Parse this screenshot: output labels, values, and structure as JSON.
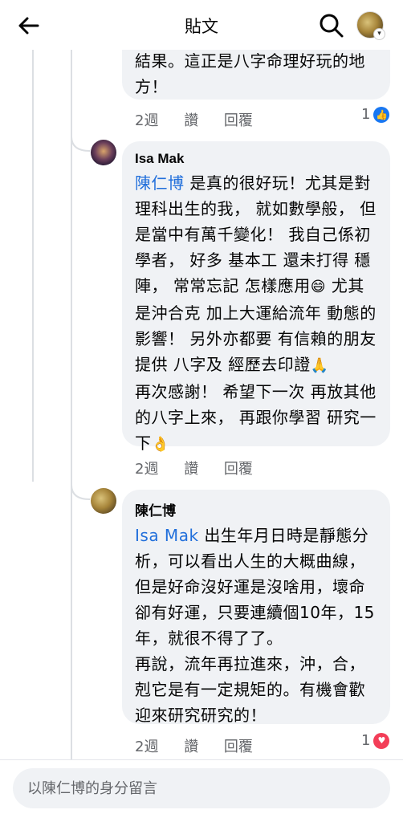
{
  "header": {
    "title": "貼文"
  },
  "comments": [
    {
      "lines": [
        "結果。這正是八字命理好玩的地",
        "方！"
      ],
      "actions": {
        "time": "2週",
        "like": "讚",
        "reply": "回覆"
      },
      "reaction_count": "1"
    },
    {
      "author": "Isa Mak",
      "mention": "陳仁博",
      "first_line_rest": " 是真的很好玩！尤其是對",
      "lines": [
        "理科出生的我， 就如數學般， 但",
        "是當中有萬千變化！ 我自己係初",
        "學者， 好多 基本工 還未打得 穩",
        "陣， 常常忘記 怎樣應用",
        "是沖合克 加上大運給流年 動態的",
        "影響！ 另外亦都要 有信賴的朋友",
        "提供 八字及 經歷去印證",
        "再次感謝！ 希望下一次 再放其他",
        "的八字上來， 再跟你學習 研究一",
        "下"
      ],
      "line4_tail": " 尤其",
      "emojis": {
        "grin": "😄",
        "pray": "🙏",
        "ok": "👌"
      },
      "actions": {
        "time": "2週",
        "like": "讚",
        "reply": "回覆"
      }
    },
    {
      "author": "陳仁博",
      "mention": "Isa Mak",
      "first_line_rest": "  出生年月日時是靜態分",
      "lines": [
        "析，可以看出人生的大概曲線，",
        "但是好命沒好運是沒啥用，壞命",
        "卻有好運，只要連續個10年，15",
        "年，就很不得了了。",
        "再說，流年再拉進來，沖，合，",
        "剋它是有一定規矩的。有機會歡",
        "迎來研究研究的！"
      ],
      "actions": {
        "time": "2週",
        "like": "讚",
        "reply": "回覆"
      },
      "reaction_count": "1"
    }
  ],
  "composer": {
    "placeholder": "以陳仁博的身分留言"
  },
  "colors": {
    "link": "#216fdb",
    "bubble": "#f0f2f5",
    "meta": "#65676b",
    "like": "#1877f2",
    "love": "#f33e58"
  }
}
